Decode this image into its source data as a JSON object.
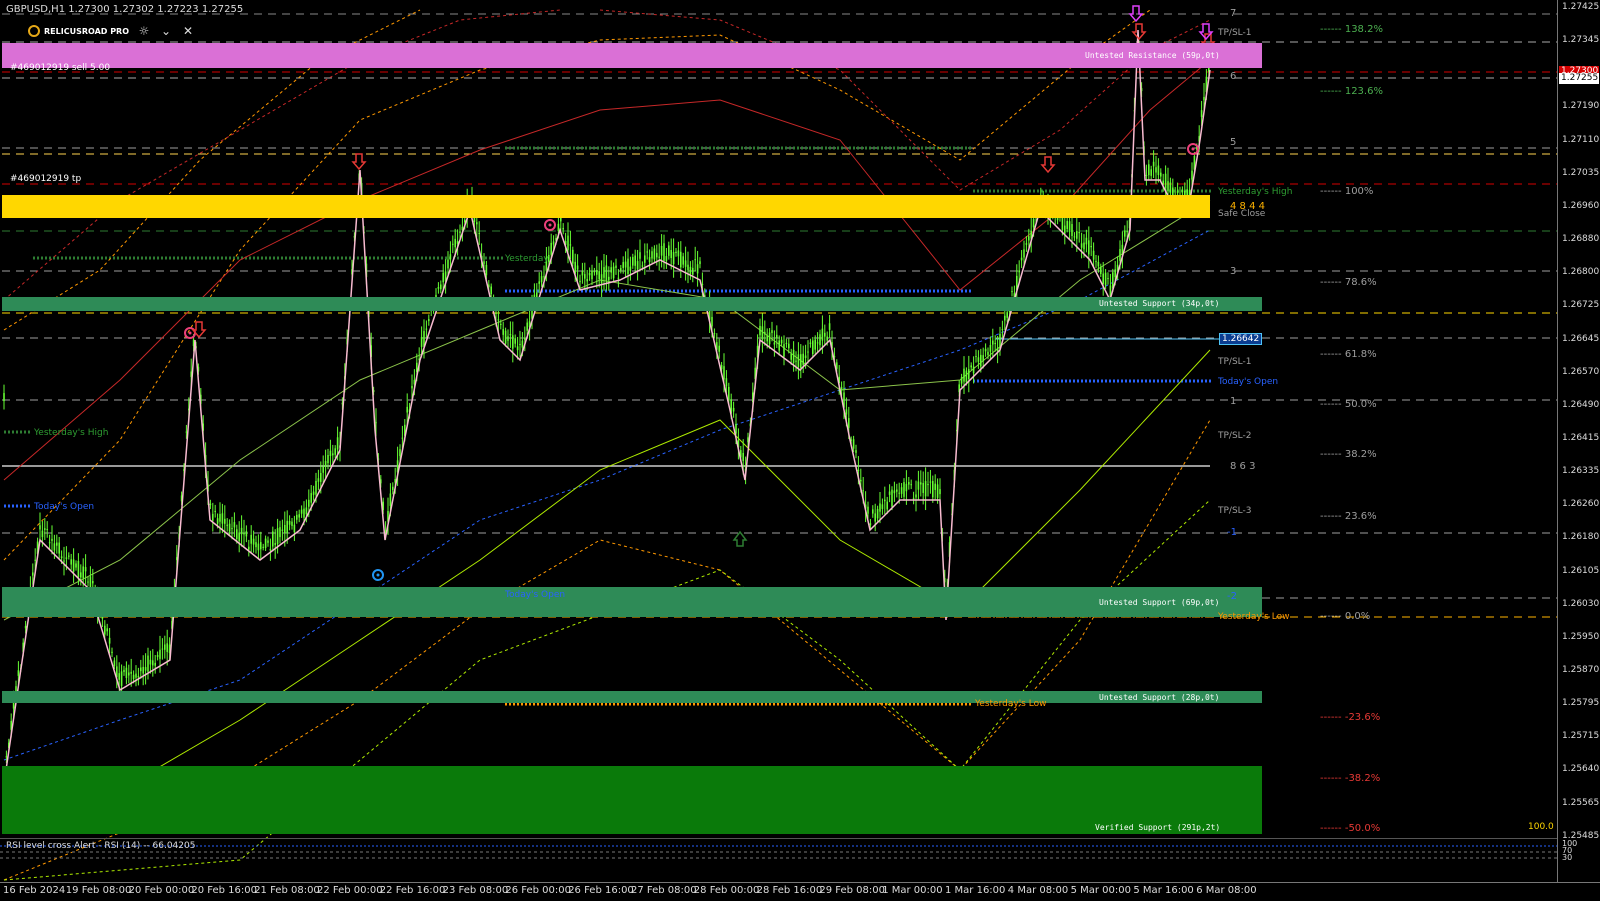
{
  "header": {
    "symbol_line": "GBPUSD,H1  1.27300 1.27302 1.27223 1.27255",
    "brand": "RELICUSROAD PRO"
  },
  "toolbar": {
    "icons": [
      "brightness-icon",
      "chevron-down-icon",
      "close-icon"
    ]
  },
  "price_axis": {
    "ticks": [
      "1.27425",
      "1.27345",
      "1.27270",
      "1.27190",
      "1.27110",
      "1.27035",
      "1.26960",
      "1.26880",
      "1.26800",
      "1.26725",
      "1.26645",
      "1.26570",
      "1.26490",
      "1.26415",
      "1.26335",
      "1.26260",
      "1.26180",
      "1.26105",
      "1.26030",
      "1.25950",
      "1.25870",
      "1.25795",
      "1.25715",
      "1.25640",
      "1.25565",
      "1.25485"
    ],
    "current_price": "1.27255",
    "current_price_color": "#ffffff",
    "red_label": "1.27300",
    "blue_label": "1.26642",
    "small_label": "100.0"
  },
  "time_axis": {
    "labels": [
      "16 Feb 2024",
      "19 Feb 08:00",
      "20 Feb 00:00",
      "20 Feb 16:00",
      "21 Feb 08:00",
      "22 Feb 00:00",
      "22 Feb 16:00",
      "23 Feb 08:00",
      "26 Feb 00:00",
      "26 Feb 16:00",
      "27 Feb 08:00",
      "28 Feb 00:00",
      "28 Feb 16:00",
      "29 Feb 08:00",
      "1 Mar 00:00",
      "1 Mar 16:00",
      "4 Mar 08:00",
      "5 Mar 00:00",
      "5 Mar 16:00",
      "6 Mar 08:00"
    ]
  },
  "zones": {
    "resistance": "Untested Resistance (59p,0t)",
    "support1": "Untested Support (34p,0t)",
    "support2": "Untested Support (69p,0t)",
    "support3": "Untested Support (28p,0t)",
    "verified": "Verified Support (291p,2t)"
  },
  "annotations": {
    "order_sell": "#469012919 sell 5.00",
    "order_tp": "#469012919 tp",
    "yesterdays_high": "Yesterday's High",
    "yesterdays_high_short": "Yesterday",
    "yesterdays_low": "Yesterday's Low",
    "todays_open": "Today's Open",
    "safe_close": "Safe Close",
    "tp_sl_1": "TP/SL-1",
    "tp_sl_2": "TP/SL-2",
    "tp_sl_3": "TP/SL-3",
    "level_7": "7",
    "level_5": "5",
    "level_3": "3",
    "level_1": "1",
    "level_m1": "-1",
    "level_m2": "-2",
    "level_6": "6",
    "counts_yellow": "4  8  4  4",
    "counts_blue": "8  6  3"
  },
  "fib_levels": [
    {
      "label": "138.2%",
      "color": "#4caf50"
    },
    {
      "label": "123.6%",
      "color": "#4caf50"
    },
    {
      "label": "100%",
      "color": "#9e9e9e"
    },
    {
      "label": "78.6%",
      "color": "#9e9e9e"
    },
    {
      "label": "61.8%",
      "color": "#9e9e9e"
    },
    {
      "label": "50.0%",
      "color": "#9e9e9e"
    },
    {
      "label": "38.2%",
      "color": "#9e9e9e"
    },
    {
      "label": "23.6%",
      "color": "#9e9e9e"
    },
    {
      "label": "0.0%",
      "color": "#9e9e9e"
    },
    {
      "label": "-23.6%",
      "color": "#e53935"
    },
    {
      "label": "-38.2%",
      "color": "#e53935"
    },
    {
      "label": "-50.0%",
      "color": "#e53935"
    }
  ],
  "indicator": {
    "label": "RSI level cross Alert - RSI (14) -- 66.04205",
    "scale_top": "100",
    "scale_mid": "70",
    "scale_bottom": "30"
  },
  "colors": {
    "candle": "#66ff33",
    "resistance_zone": "#da70d6",
    "yellow_zone": "#ffd700",
    "support_zone": "#2e8b57",
    "verified_zone": "#0a7a0a",
    "todays_open": "#2962ff",
    "yesterdays_high": "#2e7d32",
    "yesterdays_low": "#ff9800"
  }
}
